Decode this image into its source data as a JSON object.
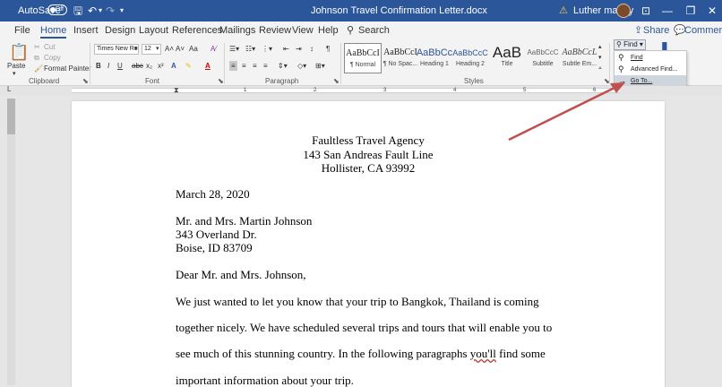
{
  "titlebar": {
    "autosave": "AutoSave",
    "autosave_state": "Off",
    "doc_title": "Johnson Travel Confirmation Letter.docx",
    "user": "Luther maddy",
    "warning_icon": "warning-icon",
    "accent": "#2b579a"
  },
  "menu": {
    "file": "File",
    "home": "Home",
    "insert": "Insert",
    "design": "Design",
    "layout": "Layout",
    "references": "References",
    "mailings": "Mailings",
    "review": "Review",
    "view": "View",
    "help": "Help",
    "search": "Search",
    "share": "Share",
    "comments": "Comments"
  },
  "ribbon": {
    "clipboard": {
      "paste": "Paste",
      "cut": "Cut",
      "copy": "Copy",
      "format_painter": "Format Painter",
      "label": "Clipboard"
    },
    "font": {
      "name": "Times New Ro",
      "size": "12",
      "label": "Font",
      "bold": "B",
      "italic": "I",
      "underline": "U",
      "strike": "abc",
      "sub": "x₂",
      "sup": "x²",
      "grow": "A˄",
      "shrink": "A˅",
      "case": "Aa"
    },
    "paragraph": {
      "label": "Paragraph"
    },
    "styles": {
      "label": "Styles",
      "items": [
        {
          "preview": "AaBbCcI",
          "name": "¶ Normal"
        },
        {
          "preview": "AaBbCcI",
          "name": "¶ No Spac..."
        },
        {
          "preview": "AaBbCc",
          "name": "Heading 1"
        },
        {
          "preview": "AaBbCcC",
          "name": "Heading 2"
        },
        {
          "preview": "AaB",
          "name": "Title"
        },
        {
          "preview": "AaBbCcC",
          "name": "Subtitle"
        },
        {
          "preview": "AaBbCcL",
          "name": "Subtle Em..."
        }
      ]
    },
    "editing": {
      "find": "Find",
      "menu": [
        "Find",
        "Advanced Find...",
        "Go To..."
      ]
    }
  },
  "ruler": {
    "numbers": [
      "1",
      "2",
      "3",
      "4",
      "5",
      "6"
    ]
  },
  "document": {
    "company": "Faultless Travel Agency",
    "address1": "143 San Andreas Fault Line",
    "address2": "Hollister, CA  93992",
    "date": "March 28, 2020",
    "recipient": "Mr. and Mrs. Martin Johnson",
    "r_address1": "343 Overland Dr.",
    "r_address2": "Boise, ID  83709",
    "greeting": "Dear Mr. and Mrs. Johnson,",
    "line1": "We just wanted to let you know that your trip to Bangkok, Thailand is coming",
    "line2": "together nicely.  We have scheduled several trips and tours that will enable you to",
    "line3_a": "see much of this stunning country.  In the following paragraphs ",
    "line3_b": "you'll",
    "line3_c": " find some",
    "line4": "important information about your trip."
  }
}
